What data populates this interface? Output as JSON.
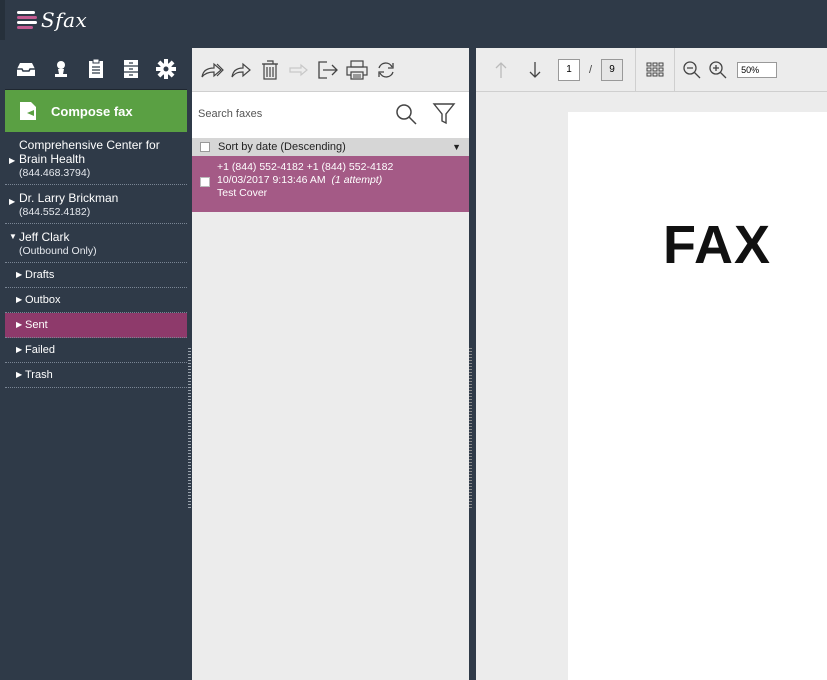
{
  "app": {
    "logo_text": "Sfax"
  },
  "sidebar": {
    "compose_label": "Compose fax",
    "accounts": [
      {
        "name": "Comprehensive Center for Brain Health",
        "phone": "(844.468.3794)"
      },
      {
        "name": "Dr. Larry Brickman",
        "phone": "(844.552.4182)"
      },
      {
        "name": "Jeff Clark",
        "phone": "(Outbound Only)"
      }
    ],
    "folders": [
      "Drafts",
      "Outbox",
      "Sent",
      "Failed",
      "Trash"
    ],
    "active_folder": "Sent"
  },
  "list": {
    "search_placeholder": "Search faxes",
    "sort_label": "Sort by date (Descending)",
    "messages": [
      {
        "numbers": "+1 (844) 552-4182 +1 (844) 552-4182",
        "datetime": "10/03/2017 9:13:46 AM",
        "attempts": "(1 attempt)",
        "subject": "Test Cover"
      }
    ]
  },
  "viewer": {
    "current_page": "1",
    "page_separator": "/",
    "total_pages": "9",
    "zoom": "50%",
    "page_heading": "FAX"
  },
  "colors": {
    "header_bg": "#2f3a48",
    "compose_green": "#5aa043",
    "active_folder": "#8e3a6b",
    "selected_message": "#a45a86"
  }
}
